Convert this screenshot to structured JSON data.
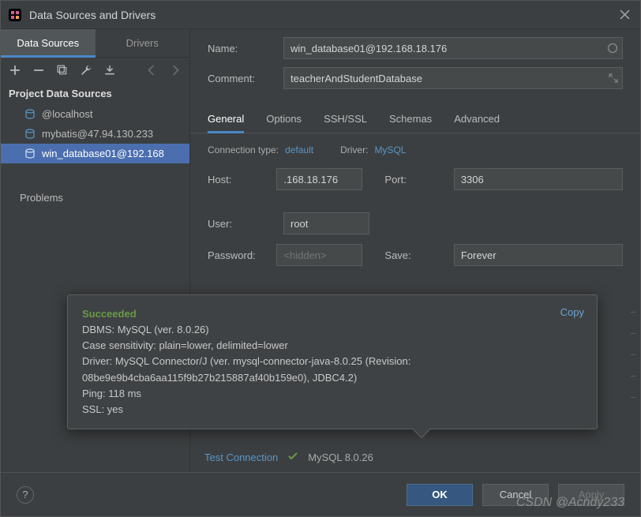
{
  "window": {
    "title": "Data Sources and Drivers"
  },
  "sidebar": {
    "tabs": {
      "data_sources": "Data Sources",
      "drivers": "Drivers"
    },
    "section_label": "Project Data Sources",
    "items": [
      {
        "label": "@localhost"
      },
      {
        "label": "mybatis@47.94.130.233"
      },
      {
        "label": "win_database01@192.168"
      }
    ],
    "problems_label": "Problems"
  },
  "form": {
    "name_label": "Name:",
    "name_value": "win_database01@192.168.18.176",
    "comment_label": "Comment:",
    "comment_value": "teacherAndStudentDatabase",
    "tabs": {
      "general": "General",
      "options": "Options",
      "sshssl": "SSH/SSL",
      "schemas": "Schemas",
      "advanced": "Advanced"
    },
    "conn_type_label": "Connection type:",
    "conn_type_value": "default",
    "driver_label": "Driver:",
    "driver_value": "MySQL",
    "host_label": "Host:",
    "host_value": ".168.18.176",
    "port_label": "Port:",
    "port_value": "3306",
    "user_label": "User:",
    "user_value": "root",
    "password_label": "Password:",
    "password_placeholder": "<hidden>",
    "save_label": "Save:",
    "save_value": "Forever"
  },
  "popup": {
    "status": "Succeeded",
    "copy": "Copy",
    "line1": "DBMS: MySQL (ver. 8.0.26)",
    "line2": "Case sensitivity: plain=lower, delimited=lower",
    "line3": "Driver: MySQL Connector/J (ver. mysql-connector-java-8.0.25 (Revision: 08be9e9b4cba6aa115f9b27b215887af40b159e0), JDBC4.2)",
    "line4": "Ping: 118 ms",
    "line5": "SSL: yes"
  },
  "test": {
    "label": "Test Connection",
    "version": "MySQL 8.0.26"
  },
  "footer": {
    "ok": "OK",
    "cancel": "Cancel",
    "apply": "Apply",
    "help": "?"
  },
  "watermark": "CSDN @Acndy233"
}
